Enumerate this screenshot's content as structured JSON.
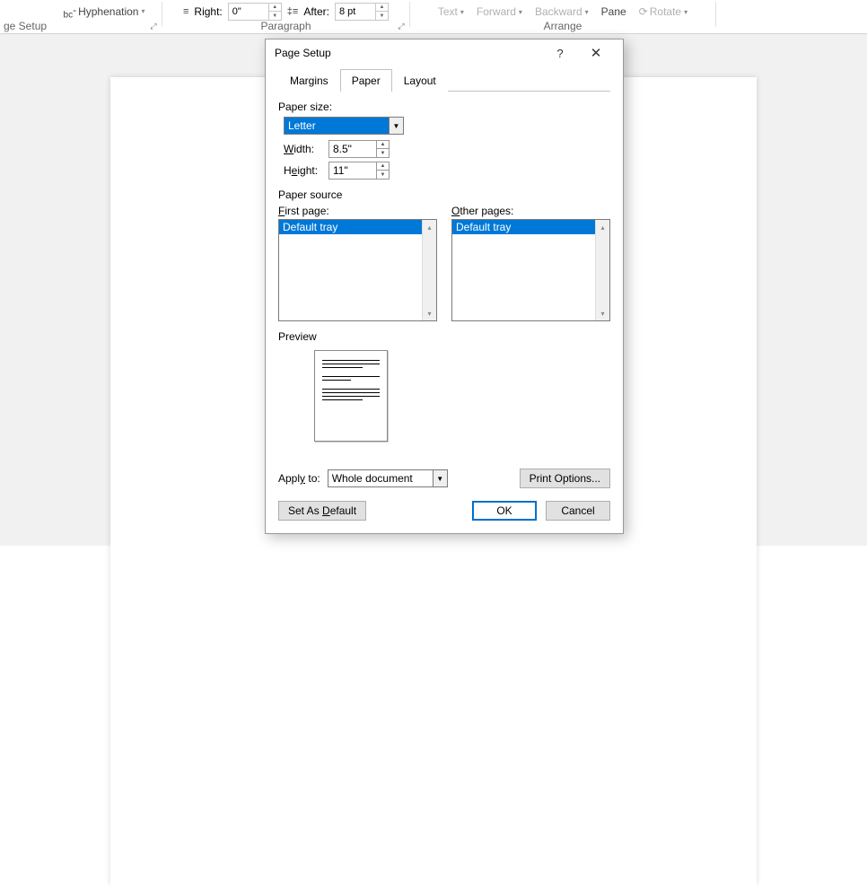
{
  "ribbon": {
    "page_setup": {
      "group_label": "ge Setup",
      "hyphenation": "Hyphenation"
    },
    "paragraph": {
      "group_label": "Paragraph",
      "right_label": "Right:",
      "right_value": "0\"",
      "after_label": "After:",
      "after_value": "8 pt"
    },
    "arrange": {
      "group_label": "Arrange",
      "text": "Text",
      "forward": "Forward",
      "backward": "Backward",
      "pane": "Pane",
      "rotate": "Rotate"
    }
  },
  "dialog": {
    "title": "Page Setup",
    "tabs": {
      "margins": "Margins",
      "paper": "Paper",
      "layout": "Layout"
    },
    "paper_size": {
      "label": "Paper size:",
      "selected": "Letter",
      "width_label": "Width:",
      "width_value": "8.5\"",
      "height_label": "Height:",
      "height_value": "11\""
    },
    "paper_source": {
      "label": "Paper source",
      "first_page_label": "First page:",
      "first_page_item": "Default tray",
      "other_pages_label": "Other pages:",
      "other_pages_item": "Default tray"
    },
    "preview": {
      "label": "Preview"
    },
    "apply": {
      "label": "Apply to:",
      "value": "Whole document",
      "print_options": "Print Options..."
    },
    "buttons": {
      "set_default": "Set As Default",
      "ok": "OK",
      "cancel": "Cancel"
    }
  }
}
